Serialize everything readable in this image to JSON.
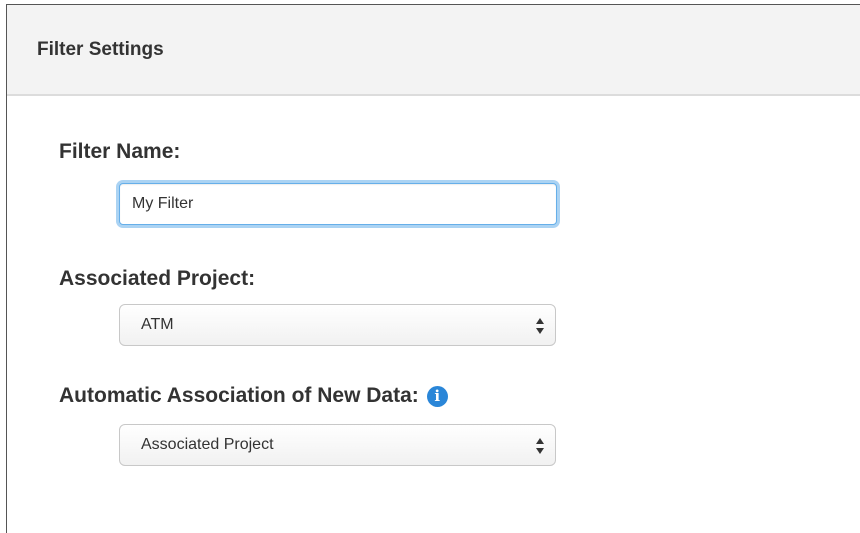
{
  "panel": {
    "title": "Filter Settings"
  },
  "form": {
    "filter_name": {
      "label": "Filter Name:",
      "value": "My Filter"
    },
    "associated_project": {
      "label": "Associated Project:",
      "selected": "ATM"
    },
    "automatic_association": {
      "label": "Automatic Association of New Data:",
      "info_icon": "info-circle-icon",
      "selected": "Associated Project"
    }
  },
  "colors": {
    "focus_ring": "#66afe9",
    "info_icon": "#2a86d8",
    "heading_background": "#f3f3f3"
  }
}
